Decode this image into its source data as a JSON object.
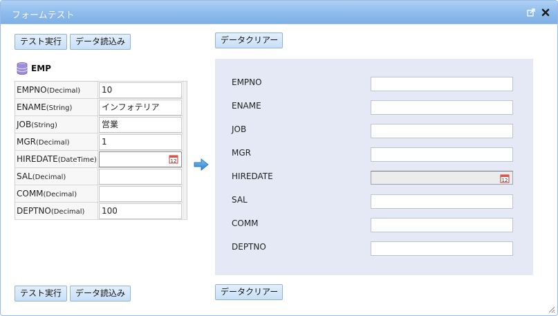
{
  "window": {
    "title": "フォームテスト"
  },
  "toolbar": {
    "run_test_label": "テスト実行",
    "load_data_label": "データ読込み",
    "clear_data_label": "データクリアー"
  },
  "table": {
    "name": "EMP",
    "rows": [
      {
        "field": "EMPNO",
        "type": "(Decimal)",
        "value": "10"
      },
      {
        "field": "ENAME",
        "type": "(String)",
        "value": "インフォテリア"
      },
      {
        "field": "JOB",
        "type": "(String)",
        "value": "営業"
      },
      {
        "field": "MGR",
        "type": "(Decimal)",
        "value": "1"
      },
      {
        "field": "HIREDATE",
        "type": "(DateTime)",
        "value": ""
      },
      {
        "field": "SAL",
        "type": "(Decimal)",
        "value": ""
      },
      {
        "field": "COMM",
        "type": "(Decimal)",
        "value": ""
      },
      {
        "field": "DEPTNO",
        "type": "(Decimal)",
        "value": "100"
      }
    ]
  },
  "form": {
    "fields": [
      {
        "label": "EMPNO",
        "value": ""
      },
      {
        "label": "ENAME",
        "value": ""
      },
      {
        "label": "JOB",
        "value": ""
      },
      {
        "label": "MGR",
        "value": ""
      },
      {
        "label": "HIREDATE",
        "value": ""
      },
      {
        "label": "SAL",
        "value": ""
      },
      {
        "label": "COMM",
        "value": ""
      },
      {
        "label": "DEPTNO",
        "value": ""
      }
    ]
  },
  "icons": {
    "popout": "popout-icon",
    "close": "close-icon",
    "database": "database-icon",
    "calendar": "calendar-icon",
    "arrow": "arrow-right-icon",
    "resize": "resize-grip-icon"
  },
  "colors": {
    "title_bar": "#8dbbec",
    "button_bg": "#d4e6f9",
    "panel_bg": "#e4e9f5",
    "arrow": "#3b8de0"
  }
}
